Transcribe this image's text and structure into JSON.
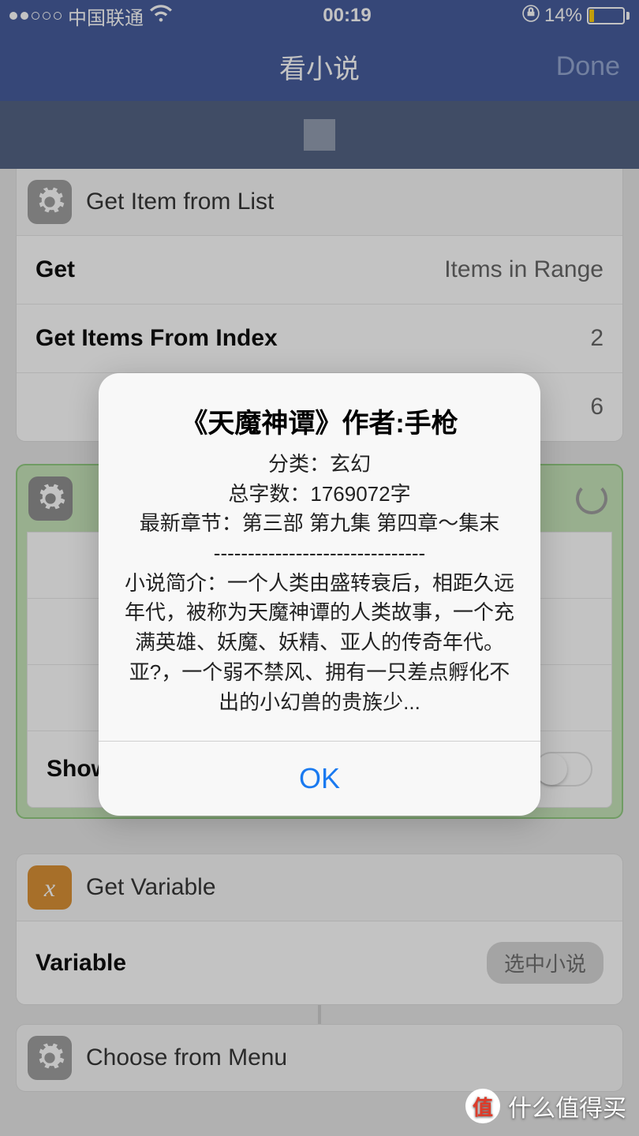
{
  "status": {
    "carrier": "中国联通",
    "time": "00:19",
    "battery_pct": "14%"
  },
  "nav": {
    "title": "看小说",
    "done": "Done"
  },
  "cards": {
    "get_item": {
      "title": "Get Item from List",
      "rows": [
        {
          "label": "Get",
          "value": "Items in Range"
        },
        {
          "label": "Get Items From Index",
          "value": "2"
        },
        {
          "label": "",
          "value": "6"
        }
      ]
    },
    "show_alert": {
      "cancel_label": "Show Cancel Button"
    },
    "get_variable": {
      "title": "Get Variable",
      "row_label": "Variable",
      "pill": "选中小说"
    },
    "choose_menu": {
      "title": "Choose from Menu"
    }
  },
  "alert": {
    "title": "《天魔神谭》作者:手枪",
    "line1": "分类：玄幻",
    "line2": "总字数：1769072字",
    "line3": "最新章节：第三部 第九集 第四章～集末",
    "divider": "-------------------------------",
    "body": "小说简介：一个人类由盛转衰后，相距久远年代，被称为天魔神谭的人类故事，一个充满英雄、妖魔、妖精、亚人的传奇年代。 亚?，一个弱不禁风、拥有一只差点孵化不出的小幻兽的贵族少...",
    "ok": "OK"
  },
  "watermark": "什么值得买"
}
